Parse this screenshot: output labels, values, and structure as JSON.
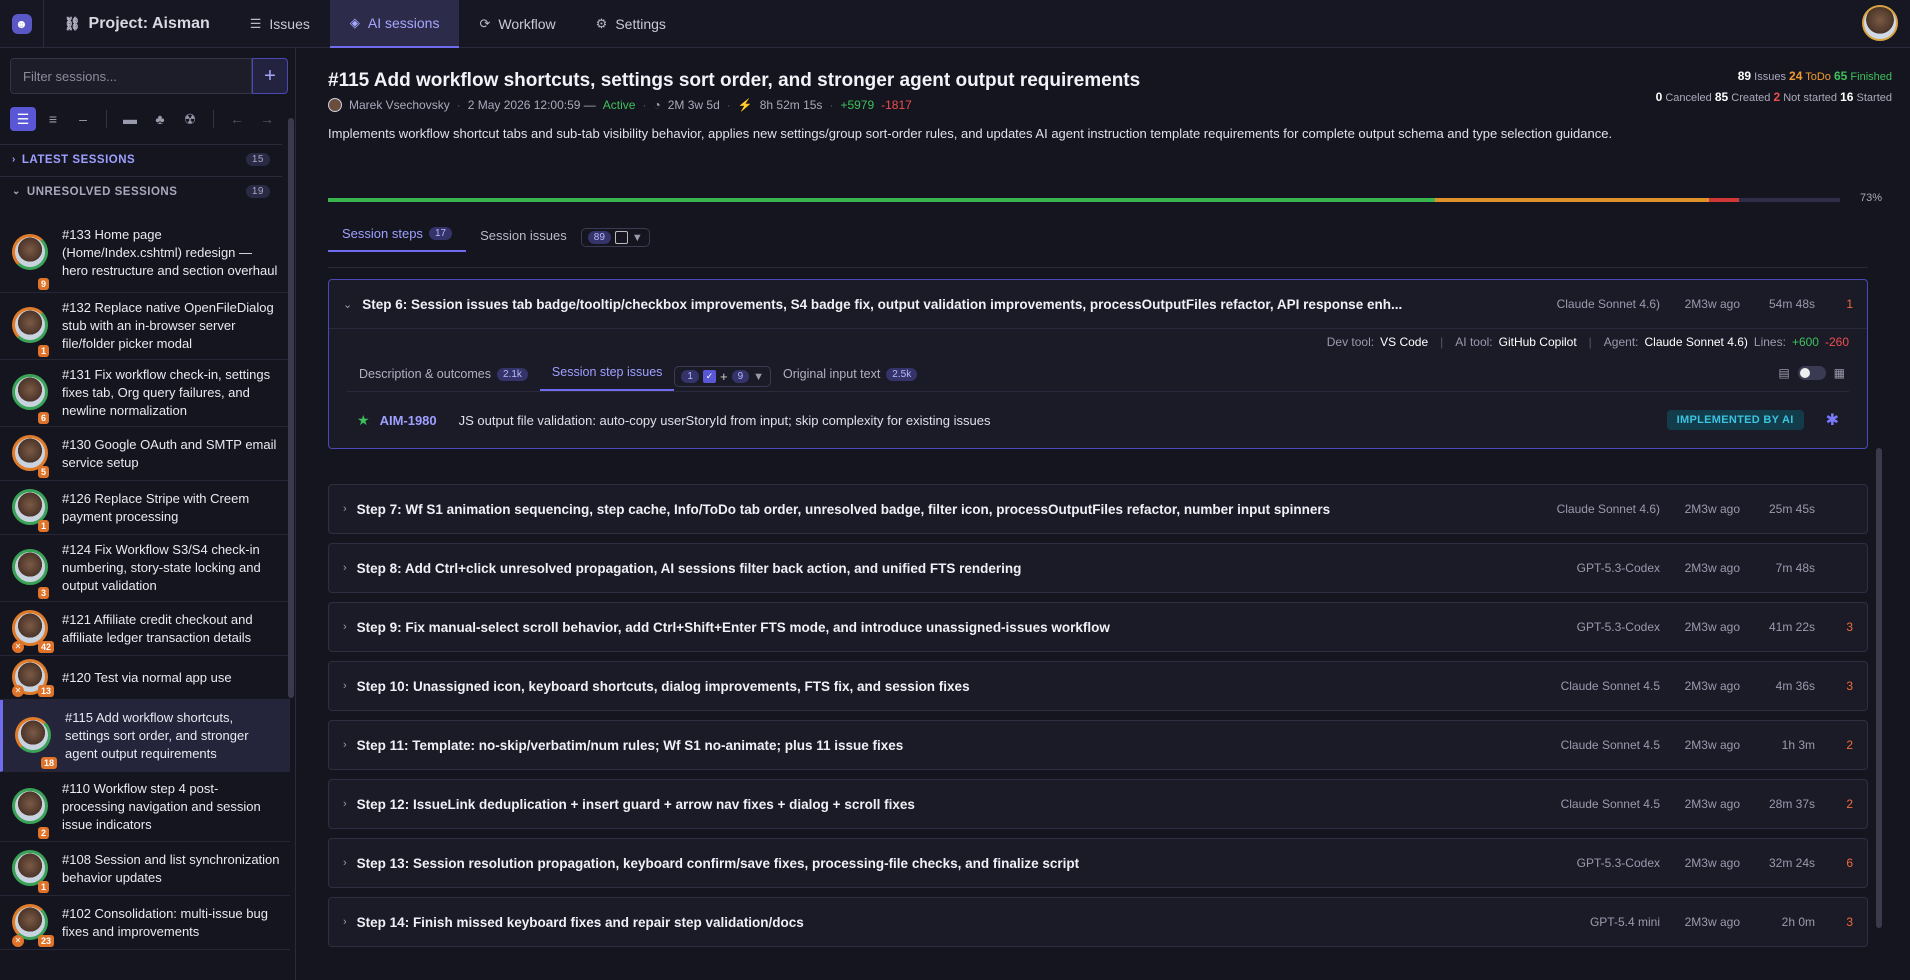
{
  "topbar": {
    "project": "Project: Aisman",
    "nav": [
      {
        "label": "Issues",
        "icon": "list-icon"
      },
      {
        "label": "AI sessions",
        "icon": "layers-icon"
      },
      {
        "label": "Workflow",
        "icon": "workflow-icon"
      },
      {
        "label": "Settings",
        "icon": "gear-icon"
      }
    ]
  },
  "sidebar": {
    "filter_placeholder": "Filter sessions...",
    "add_label": "+",
    "latest": {
      "label": "LATEST SESSIONS",
      "count": "15"
    },
    "unresolved": {
      "label": "UNRESOLVED SESSIONS",
      "count": "19"
    },
    "items": [
      {
        "text": "#133 Home page (Home/Index.cshtml) redesign — hero restructure and section overhaul",
        "badge": "9"
      },
      {
        "text": "#132 Replace native OpenFileDialog stub with an in-browser server file/folder picker modal",
        "badge": "1"
      },
      {
        "text": "#131 Fix workflow check-in, settings fixes tab, Org query failures, and newline normalization",
        "badge": "6"
      },
      {
        "text": "#130 Google OAuth and SMTP email service setup",
        "badge": "5"
      },
      {
        "text": "#126 Replace Stripe with Creem payment processing",
        "badge": "1"
      },
      {
        "text": "#124 Fix Workflow S3/S4 check-in numbering, story-state locking and output validation",
        "badge": "3"
      },
      {
        "text": "#121 Affiliate credit checkout and affiliate ledger transaction details",
        "badge": "42"
      },
      {
        "text": "#120 Test via normal app use",
        "badge": "13"
      },
      {
        "text": "#115 Add workflow shortcuts, settings sort order, and stronger agent output requirements",
        "badge": "18"
      },
      {
        "text": "#110 Workflow step 4 post-processing navigation and session issue indicators",
        "badge": "2"
      },
      {
        "text": "#108 Session and list synchronization behavior updates",
        "badge": "1"
      },
      {
        "text": "#102 Consolidation: multi-issue bug fixes and improvements",
        "badge": "23"
      }
    ]
  },
  "session": {
    "title": "#115 Add workflow shortcuts, settings sort order, and stronger agent output requirements",
    "author": "Marek Vsechovsky",
    "date": "2 May 2026 12:00:59 —",
    "status": "Active",
    "age": "2M 3w 5d",
    "duration": "8h 52m 15s",
    "added": "+5979",
    "removed": "-1817",
    "description": "Implements workflow shortcut tabs and sub-tab visibility behavior, applies new settings/group sort-order rules, and updates AI agent instruction template requirements for complete output schema and type selection guidance.",
    "progress_pct": "73%",
    "progress": {
      "finished": 0.73,
      "todo": 0.18,
      "canceled": 0.02
    }
  },
  "stats": {
    "issues": "89",
    "issues_label": "Issues",
    "todo": "24",
    "todo_label": "ToDo",
    "finished": "65",
    "finished_label": "Finished",
    "canceled": "0",
    "canceled_label": "Canceled",
    "created": "85",
    "created_label": "Created",
    "not_started": "2",
    "not_started_label": "Not started",
    "started": "16",
    "started_label": "Started"
  },
  "tabs": {
    "steps": {
      "label": "Session steps",
      "count": "17"
    },
    "issues": {
      "label": "Session issues",
      "count": "89"
    }
  },
  "open_step": {
    "title": "Step 6: Session issues tab badge/tooltip/checkbox improvements, S4 badge fix, output validation improvements, processOutputFiles refactor, API response enh...",
    "model": "Claude Sonnet 4.6)",
    "ago": "2M3w ago",
    "dur": "54m 48s",
    "num": "1",
    "dev_tool_label": "Dev tool:",
    "dev_tool": "VS Code",
    "ai_tool_label": "AI tool:",
    "ai_tool": "GitHub Copilot",
    "agent_label": "Agent:",
    "agent": "Claude Sonnet 4.6)",
    "lines_label": "Lines:",
    "lines_add": "+600",
    "lines_del": "-260",
    "subtabs": {
      "desc": {
        "label": "Description & outcomes",
        "count": "2.1k"
      },
      "issues": {
        "label": "Session step issues",
        "a": "1",
        "b": "9"
      },
      "orig": {
        "label": "Original input text",
        "count": "2.5k"
      }
    },
    "issue": {
      "key": "AIM-1980",
      "text": "JS output file validation: auto-copy userStoryId from input; skip complexity for existing issues",
      "badge": "IMPLEMENTED BY AI"
    }
  },
  "steps": [
    {
      "title": "Step 7: Wf S1 animation sequencing, step cache, Info/ToDo tab order, unresolved badge, filter icon, processOutputFiles refactor, number input spinners",
      "model": "Claude Sonnet 4.6)",
      "ago": "2M3w ago",
      "dur": "25m 45s",
      "num": ""
    },
    {
      "title": "Step 8: Add Ctrl+click unresolved propagation, AI sessions filter back action, and unified FTS rendering",
      "model": "GPT-5.3-Codex",
      "ago": "2M3w ago",
      "dur": "7m 48s",
      "num": ""
    },
    {
      "title": "Step 9: Fix manual-select scroll behavior, add Ctrl+Shift+Enter FTS mode, and introduce unassigned-issues workflow",
      "model": "GPT-5.3-Codex",
      "ago": "2M3w ago",
      "dur": "41m 22s",
      "num": "3"
    },
    {
      "title": "Step 10: Unassigned icon, keyboard shortcuts, dialog improvements, FTS fix, and session fixes",
      "model": "Claude Sonnet 4.5",
      "ago": "2M3w ago",
      "dur": "4m 36s",
      "num": "3"
    },
    {
      "title": "Step 11: Template: no-skip/verbatim/num rules; Wf S1 no-animate; plus 11 issue fixes",
      "model": "Claude Sonnet 4.5",
      "ago": "2M3w ago",
      "dur": "1h 3m",
      "num": "2"
    },
    {
      "title": "Step 12: IssueLink deduplication + insert guard + arrow nav fixes + dialog + scroll fixes",
      "model": "Claude Sonnet 4.5",
      "ago": "2M3w ago",
      "dur": "28m 37s",
      "num": "2"
    },
    {
      "title": "Step 13: Session resolution propagation, keyboard confirm/save fixes, processing-file checks, and finalize script",
      "model": "GPT-5.3-Codex",
      "ago": "2M3w ago",
      "dur": "32m 24s",
      "num": "6"
    },
    {
      "title": "Step 14: Finish missed keyboard fixes and repair step validation/docs",
      "model": "GPT-5.4 mini",
      "ago": "2M3w ago",
      "dur": "2h 0m",
      "num": "3"
    }
  ]
}
